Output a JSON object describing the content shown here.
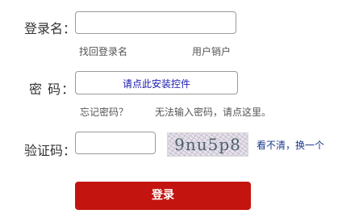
{
  "form": {
    "username_label": "登录名：",
    "password_label": "密  码：",
    "captcha_label": "验证码：",
    "install_control_text": "请点此安装控件",
    "find_username_link": "找回登录名",
    "logout_link": "用户销户",
    "forgot_password_link": "忘记密码？",
    "cannot_input_link": "无法输入密码，请点这里。",
    "captcha_text": "9nu5p8",
    "refresh_captcha_link": "看不清，换一个",
    "login_button": "登录"
  }
}
